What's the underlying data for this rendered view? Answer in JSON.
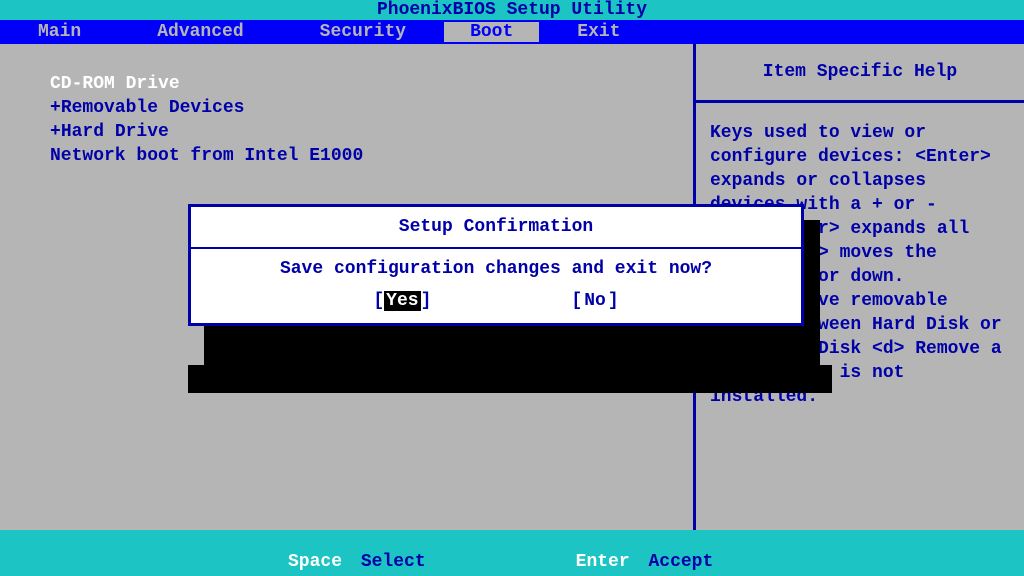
{
  "title": "PhoenixBIOS Setup Utility",
  "menu": {
    "items": [
      "Main",
      "Advanced",
      "Security",
      "Boot",
      "Exit"
    ],
    "active_index": 3
  },
  "boot_order": {
    "items": [
      {
        "label": "CD-ROM Drive",
        "selected": true,
        "prefix": ""
      },
      {
        "label": "Removable Devices",
        "selected": false,
        "prefix": "+"
      },
      {
        "label": "Hard Drive",
        "selected": false,
        "prefix": "+"
      },
      {
        "label": "Network boot from Intel E1000",
        "selected": false,
        "prefix": ""
      }
    ]
  },
  "help": {
    "title": "Item Specific Help",
    "text": "Keys used to view or configure devices:\n<Enter> expands or collapses devices with a + or -\n<Ctrl+Enter> expands all\n<+> and <-> moves the device up or down.\n<n> May move removable device between Hard Disk or Removable Disk\n<d> Remove a device that is not installed."
  },
  "footer": {
    "key1": "Space",
    "label1": "Select",
    "key2": "Enter",
    "label2": "Accept"
  },
  "modal": {
    "title": "Setup Confirmation",
    "message": "Save configuration changes and exit now?",
    "yes_label": "Yes",
    "no_label": "No"
  }
}
